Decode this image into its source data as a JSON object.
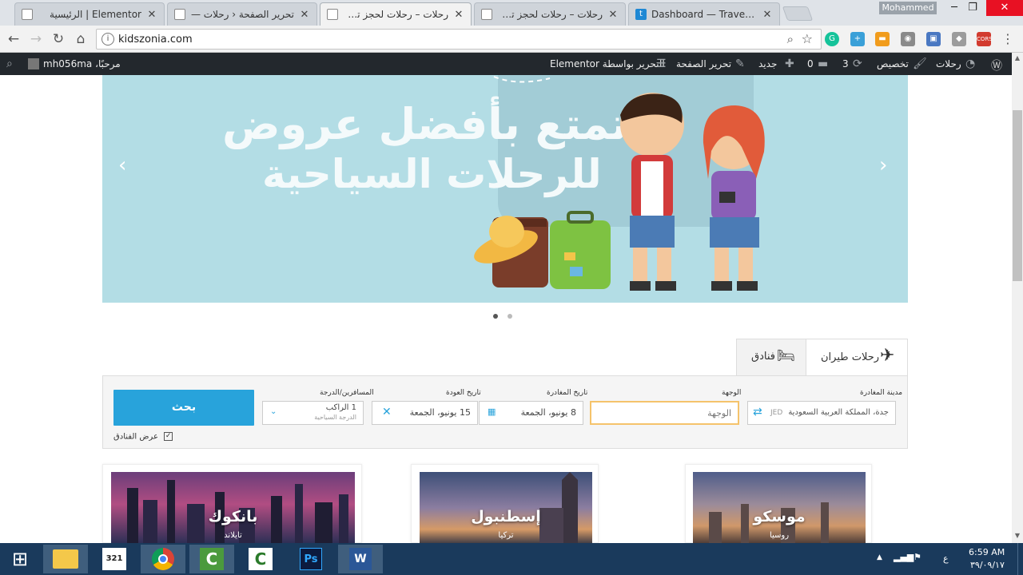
{
  "browser": {
    "tabs": [
      {
        "title": "Elementor | الرئيسية",
        "active": false
      },
      {
        "title": "تحرير الصفحة ‹ رحلات —",
        "active": false
      },
      {
        "title": "رحلات – رحلات لحجز تذاكر",
        "active": true
      },
      {
        "title": "رحلات – رحلات لحجز تذاكر",
        "active": false
      },
      {
        "title": "Dashboard — Travelpayo",
        "active": false
      }
    ],
    "profile_name": "Mohammed",
    "url": "kidszonia.com"
  },
  "adminbar": {
    "greeting": "مرحبًا، mh056ma",
    "elementor_edit": "التحرير بواسطة Elementor",
    "edit_page": "تحرير الصفحة",
    "new": "جديد",
    "comments_count": "0",
    "updates_count": "3",
    "customize": "تخصيص",
    "site_name": "رحلات"
  },
  "hero": {
    "line1": "تمتع بأفضل عروض",
    "line2": "للرحلات السياحية"
  },
  "search": {
    "tab_flights": "رحلات طيران",
    "tab_hotels": "فنادق",
    "origin_label": "مدينة المغادرة",
    "origin_value": "جدة، المملكة العربية السعودية",
    "origin_code": "JED",
    "dest_label": "الوجهة",
    "dest_placeholder": "الوجهة",
    "depart_label": "تاريخ المغادرة",
    "depart_value": "8 يونيو، الجمعة",
    "return_label": "تاريخ العودة",
    "return_value": "15 يونيو، الجمعة",
    "pax_label": "المسافرين/الدرجة",
    "pax_value": "1 الراكب",
    "class_value": "الدرجة السياحية",
    "search_button": "بحث",
    "hotels_checkbox": "عرض الفنادق"
  },
  "destinations": [
    {
      "city": "بانكوك",
      "country": "تايلاند"
    },
    {
      "city": "إسطنبول",
      "country": "تركيا"
    },
    {
      "city": "موسكو",
      "country": "روسيا"
    }
  ],
  "taskbar": {
    "time": "6:59 AM",
    "date": "٣٩/٠٩/١٧",
    "lang": "ع"
  },
  "colors": {
    "hero_bg": "#b3dde5",
    "search_button": "#28a3db",
    "adminbar": "#23282d",
    "taskbar": "#1a3a5c"
  }
}
